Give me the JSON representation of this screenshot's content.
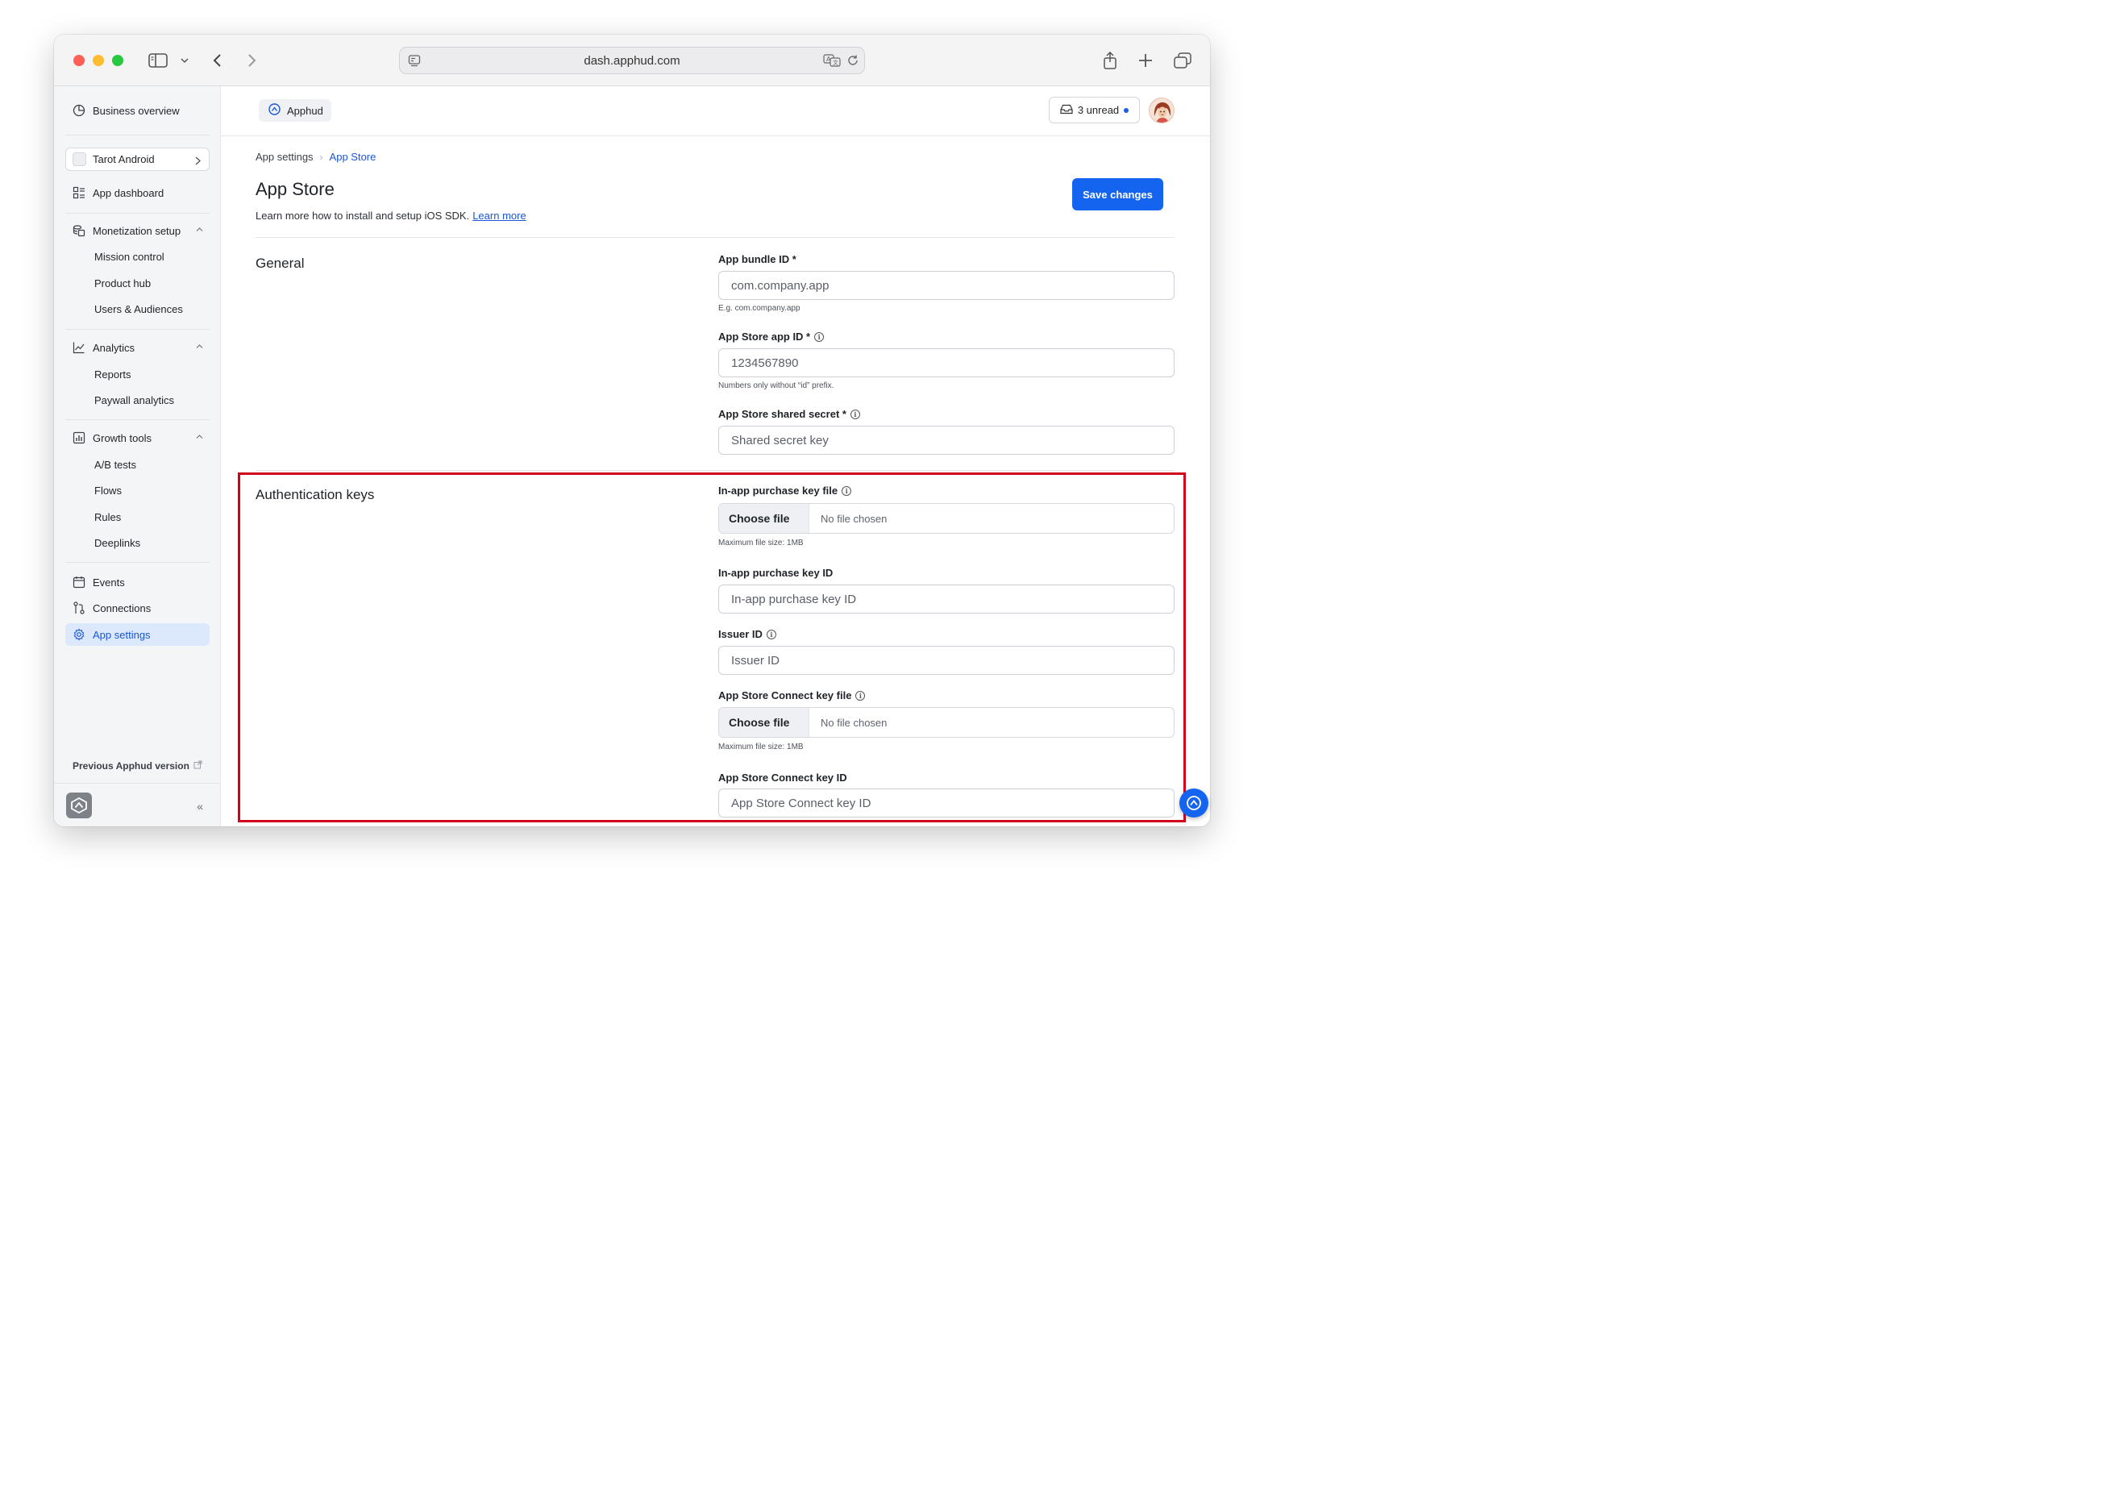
{
  "browser": {
    "url": "dash.apphud.com"
  },
  "sidebar": {
    "business_overview": "Business overview",
    "app_selector": "Tarot Android",
    "app_dashboard": "App dashboard",
    "monetization": {
      "label": "Monetization setup",
      "items": [
        "Mission control",
        "Product hub",
        "Users & Audiences"
      ]
    },
    "analytics": {
      "label": "Analytics",
      "items": [
        "Reports",
        "Paywall analytics"
      ]
    },
    "growth": {
      "label": "Growth tools",
      "items": [
        "A/B tests",
        "Flows",
        "Rules",
        "Deeplinks"
      ]
    },
    "events": "Events",
    "connections": "Connections",
    "app_settings": "App settings",
    "previous_version": "Previous Apphud version",
    "collapse_glyph": "«"
  },
  "topbar": {
    "org_name": "Apphud",
    "unread_label": "3 unread"
  },
  "breadcrumb": {
    "parent": "App settings",
    "separator": "›",
    "current": "App Store"
  },
  "page": {
    "title": "App Store",
    "subtitle": "Learn more how to install and setup iOS SDK.",
    "learn_more": "Learn more",
    "save_label": "Save changes"
  },
  "general": {
    "title": "General",
    "bundle_id": {
      "label": "App bundle ID *",
      "placeholder": "com.company.app",
      "hint": "E.g. com.company.app"
    },
    "app_id": {
      "label": "App Store app ID *",
      "placeholder": "1234567890",
      "hint": "Numbers only without “id” prefix."
    },
    "shared_secret": {
      "label": "App Store shared secret *",
      "placeholder": "Shared secret key"
    }
  },
  "auth_keys": {
    "title": "Authentication keys",
    "iap_key_file": {
      "label": "In-app purchase key file",
      "button": "Choose file",
      "status": "No file chosen",
      "hint": "Maximum file size: 1MB"
    },
    "iap_key_id": {
      "label": "In-app purchase key ID",
      "placeholder": "In-app purchase key ID"
    },
    "issuer_id": {
      "label": "Issuer ID",
      "placeholder": "Issuer ID"
    },
    "asc_key_file": {
      "label": "App Store Connect key file",
      "button": "Choose file",
      "status": "No file chosen",
      "hint": "Maximum file size: 1MB"
    },
    "asc_key_id": {
      "label": "App Store Connect key ID",
      "placeholder": "App Store Connect key ID"
    }
  },
  "colors": {
    "accent": "#1464f0",
    "highlight_border": "#d0021b",
    "active_nav_bg": "#dce8fb"
  }
}
